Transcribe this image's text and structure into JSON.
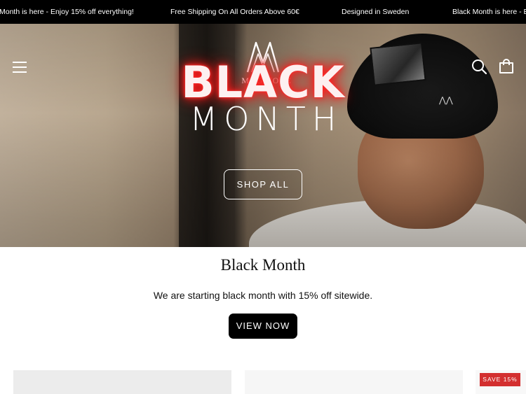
{
  "announcement": {
    "items": [
      "Month is here - Enjoy 15% off everything!",
      "Free Shipping On All Orders Above 60€",
      "Designed in Sweden",
      "Black Month is here - En"
    ]
  },
  "header": {
    "brand": "MAGLIORE",
    "icons": [
      "menu-icon",
      "search-icon",
      "shopping-bag-icon"
    ]
  },
  "hero": {
    "headline_line1": "BLACK",
    "headline_line2": "MONTH",
    "cta_label": "SHOP ALL"
  },
  "section": {
    "title": "Black Month",
    "text": "We are starting black month with 15% off sitewide.",
    "cta_label": "VIEW NOW"
  },
  "products": {
    "badge": "SAVE 15%"
  },
  "colors": {
    "announcement_bg": "#000000",
    "accent_glow": "#ff1e1e",
    "badge_bg": "#d32f2f",
    "button_bg": "#000000"
  }
}
